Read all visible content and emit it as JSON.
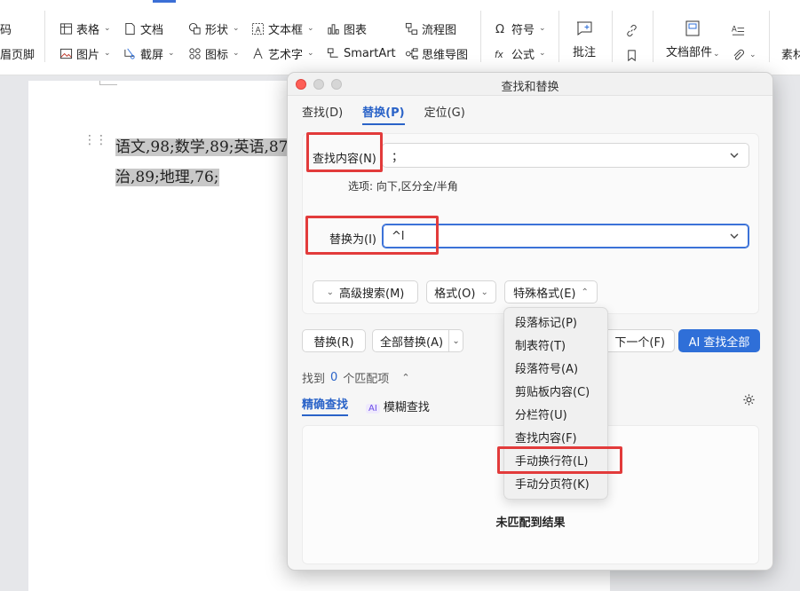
{
  "ribbon": {
    "row1": {
      "partial_left": "码",
      "table": "表格",
      "document": "文档",
      "shapes": "形状",
      "textbox": "文本框",
      "chart": "图表",
      "flowchart": "流程图",
      "symbol": "符号"
    },
    "row2": {
      "partial_left": "眉页脚",
      "picture": "图片",
      "screenshot": "截屏",
      "icons": "图标",
      "wordart": "艺术字",
      "smartart": "SmartArt",
      "mindmap": "思维导图",
      "formula": "公式"
    },
    "comment": "批注",
    "doc_parts": "文档部件",
    "material": "素材"
  },
  "document": {
    "line1": "语文,98;数学,89;英语,87;",
    "line2": "治,89;地理,76;"
  },
  "dialog": {
    "title": "查找和替换",
    "tabs": [
      "查找(D)",
      "替换(P)",
      "定位(G)"
    ],
    "active_tab": "替换(P)",
    "find_label": "查找内容(N)",
    "find_value": "；",
    "options_text": "选项:  向下,区分全/半角",
    "replace_label": "替换为(I)",
    "replace_value": "^l",
    "advanced_search": "高级搜索(M)",
    "format": "格式(O)",
    "special_format": "特殊格式(E)",
    "replace_btn": "替换(R)",
    "replace_all_btn": "全部替换(A)",
    "next_btn": "下一个(F)",
    "ai_find_all": "AI 查找全部",
    "match_prefix": "找到",
    "match_count": "0",
    "match_suffix": "个匹配项",
    "exact_find": "精确查找",
    "ai_chip": "AI",
    "fuzzy_find": "模糊查找",
    "no_result": "未匹配到结果"
  },
  "special_menu": {
    "items": [
      "段落标记(P)",
      "制表符(T)",
      "段落符号(A)",
      "剪贴板内容(C)",
      "分栏符(U)",
      "查找内容(F)",
      "手动换行符(L)",
      "手动分页符(K)"
    ],
    "highlighted": "手动换行符(L)"
  },
  "colors": {
    "accent": "#2f6fd8",
    "highlight_box": "#e23b3b"
  }
}
